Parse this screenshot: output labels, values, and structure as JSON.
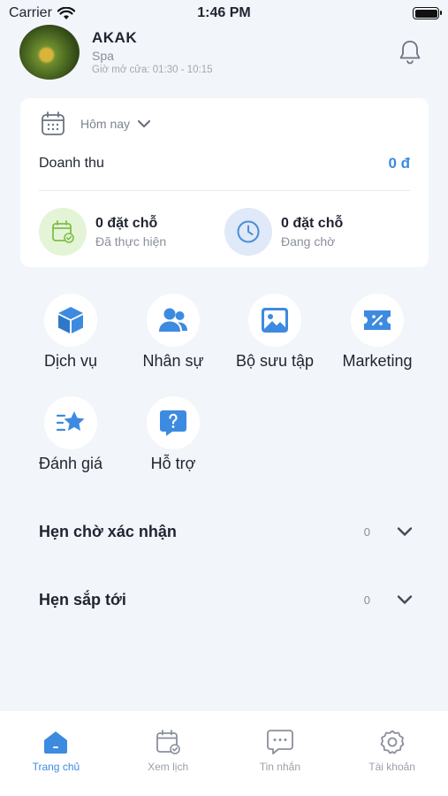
{
  "status_bar": {
    "carrier": "Carrier",
    "time": "1:46 PM"
  },
  "header": {
    "name": "AKAK",
    "type": "Spa",
    "hours": "Giờ mở cửa: 01:30 - 10:15"
  },
  "summary": {
    "date_filter": "Hôm nay",
    "revenue_label": "Doanh thu",
    "revenue_value": "0 đ",
    "stats": [
      {
        "count": "0 đặt chỗ",
        "label": "Đã thực hiện"
      },
      {
        "count": "0 đặt chỗ",
        "label": "Đang chờ"
      }
    ]
  },
  "features": [
    {
      "label": "Dịch vụ",
      "icon": "cube-icon"
    },
    {
      "label": "Nhân sự",
      "icon": "users-icon"
    },
    {
      "label": "Bộ sưu tập",
      "icon": "image-icon"
    },
    {
      "label": "Marketing",
      "icon": "ticket-icon"
    },
    {
      "label": "Đánh giá",
      "icon": "star-list-icon"
    },
    {
      "label": "Hỗ trợ",
      "icon": "help-chat-icon"
    }
  ],
  "appointments": [
    {
      "title": "Hẹn chờ xác nhận",
      "count": "0"
    },
    {
      "title": "Hẹn sắp tới",
      "count": "0"
    }
  ],
  "tabs": [
    {
      "label": "Trang chủ",
      "icon": "home-icon",
      "active": true
    },
    {
      "label": "Xem lịch",
      "icon": "calendar-icon",
      "active": false
    },
    {
      "label": "Tin nhắn",
      "icon": "chat-icon",
      "active": false
    },
    {
      "label": "Tài khoản",
      "icon": "gear-icon",
      "active": false
    }
  ],
  "colors": {
    "accent": "#3d8be0",
    "background": "#f2f5fa",
    "done_circle": "#e4f4d6",
    "pending_circle": "#dfe9f7"
  }
}
